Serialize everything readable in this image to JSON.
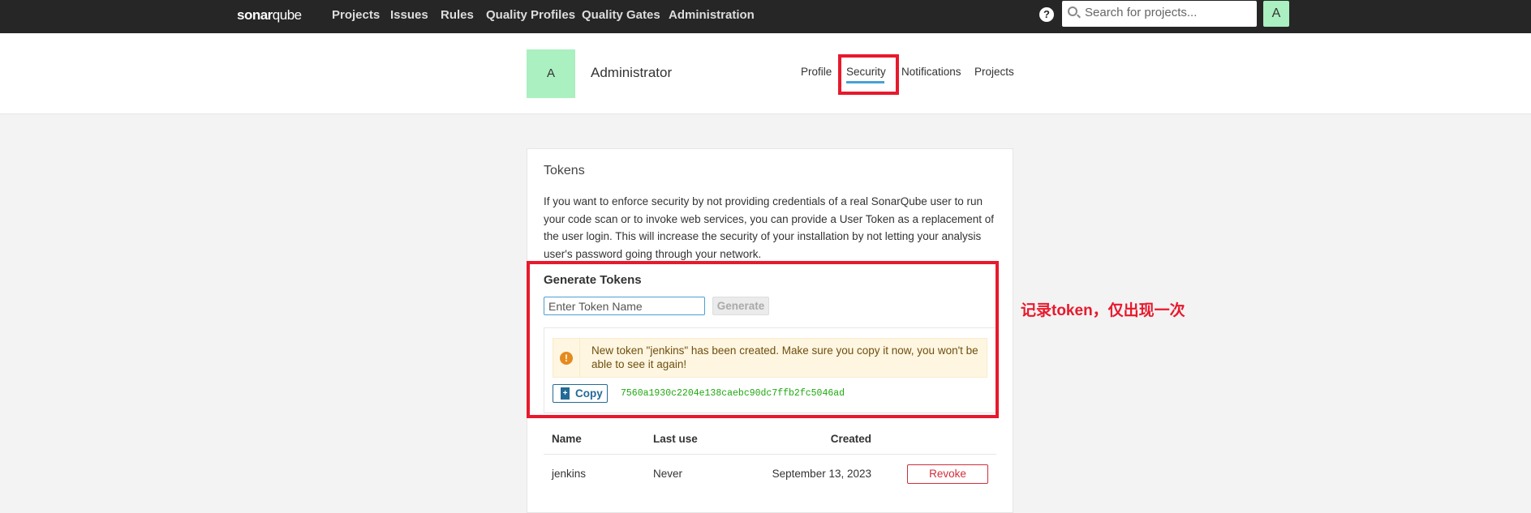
{
  "navbar": {
    "logo_bold": "sonar",
    "logo_light": "qube",
    "links": [
      "Projects",
      "Issues",
      "Rules",
      "Quality Profiles",
      "Quality Gates",
      "Administration"
    ],
    "help": "?",
    "search_placeholder": "Search for projects...",
    "avatar": "A"
  },
  "header": {
    "avatar": "A",
    "username": "Administrator",
    "tabs": [
      "Profile",
      "Security",
      "Notifications",
      "Projects"
    ],
    "active_tab": "Security"
  },
  "tokens": {
    "title": "Tokens",
    "description": "If you want to enforce security by not providing credentials of a real SonarQube user to run your code scan or to invoke web services, you can provide a User Token as a replacement of the user login. This will increase the security of your installation by not letting your analysis user's password going through your network.",
    "generate_title": "Generate Tokens",
    "input_placeholder": "Enter Token Name",
    "generate_label": "Generate",
    "alert": "New token \"jenkins\" has been created. Make sure you copy it now, you won't be able to see it again!",
    "copy_label": "Copy",
    "token_value": "7560a1930c2204e138caebc90dc7ffb2fc5046ad",
    "table": {
      "headers": [
        "Name",
        "Last use",
        "Created"
      ],
      "rows": [
        {
          "name": "jenkins",
          "last_use": "Never",
          "created": "September 13, 2023",
          "action": "Revoke"
        }
      ]
    }
  },
  "annotation": "记录token，仅出现一次",
  "colors": {
    "navbar": "#262626",
    "accent": "#4b9fd5",
    "highlight": "#e8192c",
    "token": "#1ea90f",
    "danger": "#d02f3a"
  }
}
